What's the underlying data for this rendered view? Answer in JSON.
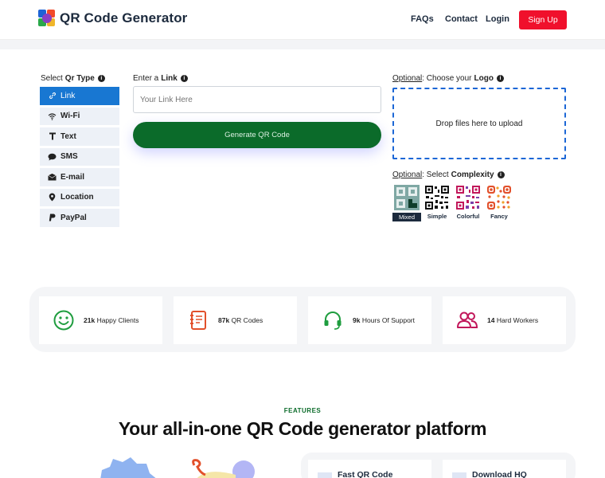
{
  "header": {
    "brand": "QR Code Generator",
    "nav": [
      "FAQs",
      "Contact",
      "Login"
    ],
    "signup_label": "Sign Up"
  },
  "qr_type": {
    "label_prefix": "Select",
    "label_bold": "Qr Type",
    "items": [
      {
        "label": "Link",
        "icon": "link-icon",
        "active": true
      },
      {
        "label": "Wi-Fi",
        "icon": "wifi-icon"
      },
      {
        "label": "Text",
        "icon": "text-icon"
      },
      {
        "label": "SMS",
        "icon": "sms-icon"
      },
      {
        "label": "E-mail",
        "icon": "email-icon"
      },
      {
        "label": "Location",
        "icon": "location-icon"
      },
      {
        "label": "PayPal",
        "icon": "paypal-icon"
      }
    ]
  },
  "link": {
    "label_prefix": "Enter a",
    "label_bold": "Link",
    "placeholder": "Your Link Here",
    "generate_label": "Generate QR Code"
  },
  "logo": {
    "optional": "Optional",
    "label_prefix": ": Choose your",
    "label_bold": "Logo",
    "drop_text": "Drop files here to upload"
  },
  "complexity": {
    "optional": "Optional",
    "label_prefix": ": Select",
    "label_bold": "Complexity",
    "options": [
      {
        "label": "Mixed",
        "active": true
      },
      {
        "label": "Simple"
      },
      {
        "label": "Colorful"
      },
      {
        "label": "Fancy"
      }
    ]
  },
  "stats": [
    {
      "value": "21k",
      "label": "Happy Clients",
      "icon": "smiley-icon",
      "color": "#1f9d3f"
    },
    {
      "value": "87k",
      "label": "QR Codes",
      "icon": "notebook-icon",
      "color": "#e2502b"
    },
    {
      "value": "9k",
      "label": "Hours Of Support",
      "icon": "headset-icon",
      "color": "#1f9d3f"
    },
    {
      "value": "14",
      "label": "Hard Workers",
      "icon": "users-icon",
      "color": "#c2185b"
    }
  ],
  "features": {
    "tag": "FEATURES",
    "title": "Your all-in-one QR Code generator platform",
    "cards": [
      "Fast QR Code",
      "Download HQ"
    ]
  },
  "colors": {
    "accent": "#1877d2",
    "primary_green": "#0b6b2a",
    "signup_red": "#f0102c"
  }
}
